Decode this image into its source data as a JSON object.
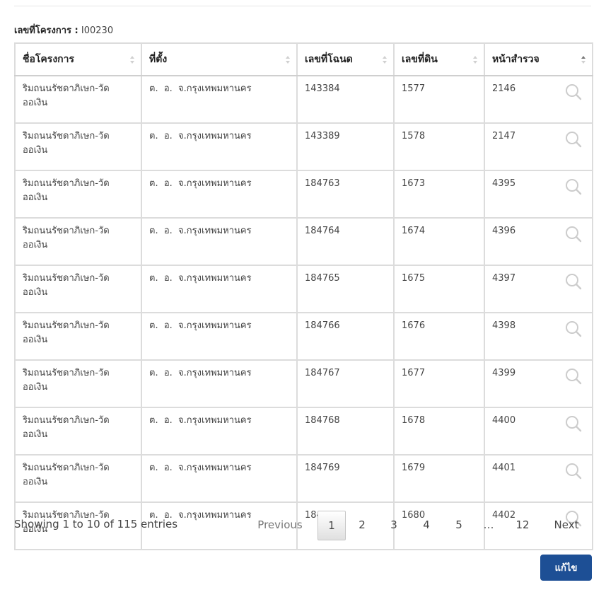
{
  "project": {
    "label": "เลขที่โครงการ :",
    "id": "I00230"
  },
  "table": {
    "headers": [
      "ชื่อโครงการ",
      "ที่ตั้ง",
      "เลขที่โฉนด",
      "เลขที่ดิน",
      "หน้าสำรวจ"
    ],
    "rows": [
      {
        "name_line1": "ริมถนนรัชดาภิเษก-วัด",
        "name_line2": "ออเงิน",
        "location": "ต.  อ.  จ.กรุงเทพมหานคร",
        "deed": "143384",
        "land": "1577",
        "survey": "2146"
      },
      {
        "name_line1": "ริมถนนรัชดาภิเษก-วัด",
        "name_line2": "ออเงิน",
        "location": "ต.  อ.  จ.กรุงเทพมหานคร",
        "deed": "143389",
        "land": "1578",
        "survey": "2147"
      },
      {
        "name_line1": "ริมถนนรัชดาภิเษก-วัด",
        "name_line2": "ออเงิน",
        "location": "ต.  อ.  จ.กรุงเทพมหานคร",
        "deed": "184763",
        "land": "1673",
        "survey": "4395"
      },
      {
        "name_line1": "ริมถนนรัชดาภิเษก-วัด",
        "name_line2": "ออเงิน",
        "location": "ต.  อ.  จ.กรุงเทพมหานคร",
        "deed": "184764",
        "land": "1674",
        "survey": "4396"
      },
      {
        "name_line1": "ริมถนนรัชดาภิเษก-วัด",
        "name_line2": "ออเงิน",
        "location": "ต.  อ.  จ.กรุงเทพมหานคร",
        "deed": "184765",
        "land": "1675",
        "survey": "4397"
      },
      {
        "name_line1": "ริมถนนรัชดาภิเษก-วัด",
        "name_line2": "ออเงิน",
        "location": "ต.  อ.  จ.กรุงเทพมหานคร",
        "deed": "184766",
        "land": "1676",
        "survey": "4398"
      },
      {
        "name_line1": "ริมถนนรัชดาภิเษก-วัด",
        "name_line2": "ออเงิน",
        "location": "ต.  อ.  จ.กรุงเทพมหานคร",
        "deed": "184767",
        "land": "1677",
        "survey": "4399"
      },
      {
        "name_line1": "ริมถนนรัชดาภิเษก-วัด",
        "name_line2": "ออเงิน",
        "location": "ต.  อ.  จ.กรุงเทพมหานคร",
        "deed": "184768",
        "land": "1678",
        "survey": "4400"
      },
      {
        "name_line1": "ริมถนนรัชดาภิเษก-วัด",
        "name_line2": "ออเงิน",
        "location": "ต.  อ.  จ.กรุงเทพมหานคร",
        "deed": "184769",
        "land": "1679",
        "survey": "4401"
      },
      {
        "name_line1": "ริมถนนรัชดาภิเษก-วัด",
        "name_line2": "ออเงิน",
        "location": "ต.  อ.  จ.กรุงเทพมหานคร",
        "deed": "184770",
        "land": "1680",
        "survey": "4402"
      }
    ],
    "row_action_icon": "search-icon"
  },
  "footer": {
    "info": "Showing 1 to 10 of 115 entries",
    "pagination": {
      "previous": "Previous",
      "pages": [
        "1",
        "2",
        "3",
        "4",
        "5",
        "…",
        "12"
      ],
      "next": "Next",
      "active": "1"
    }
  },
  "actions": {
    "edit_label": "แก้ไข"
  },
  "colors": {
    "primary_button": "#1d4f95",
    "border": "#dcdcdc",
    "icon": "#cccccc"
  }
}
